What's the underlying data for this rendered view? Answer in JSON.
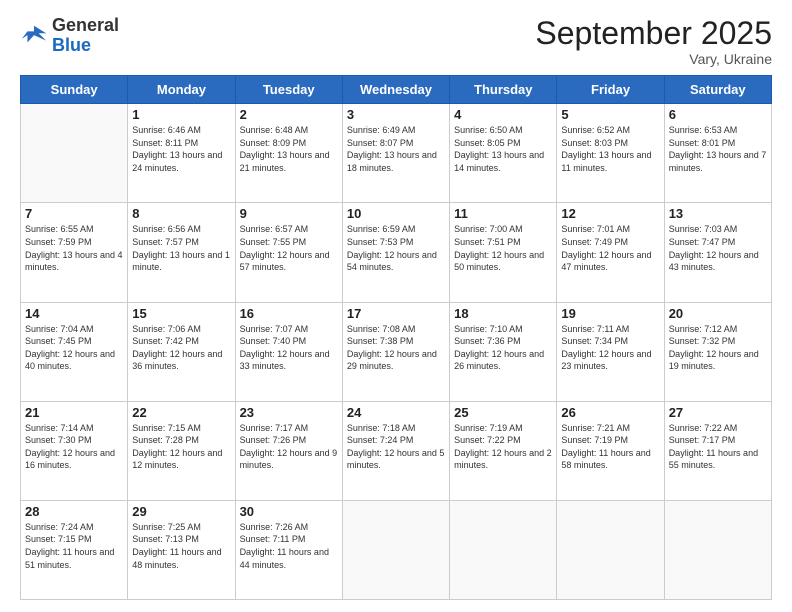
{
  "logo": {
    "text_general": "General",
    "text_blue": "Blue"
  },
  "header": {
    "month": "September 2025",
    "location": "Vary, Ukraine"
  },
  "weekdays": [
    "Sunday",
    "Monday",
    "Tuesday",
    "Wednesday",
    "Thursday",
    "Friday",
    "Saturday"
  ],
  "weeks": [
    [
      {
        "day": "",
        "sunrise": "",
        "sunset": "",
        "daylight": ""
      },
      {
        "day": "1",
        "sunrise": "Sunrise: 6:46 AM",
        "sunset": "Sunset: 8:11 PM",
        "daylight": "Daylight: 13 hours and 24 minutes."
      },
      {
        "day": "2",
        "sunrise": "Sunrise: 6:48 AM",
        "sunset": "Sunset: 8:09 PM",
        "daylight": "Daylight: 13 hours and 21 minutes."
      },
      {
        "day": "3",
        "sunrise": "Sunrise: 6:49 AM",
        "sunset": "Sunset: 8:07 PM",
        "daylight": "Daylight: 13 hours and 18 minutes."
      },
      {
        "day": "4",
        "sunrise": "Sunrise: 6:50 AM",
        "sunset": "Sunset: 8:05 PM",
        "daylight": "Daylight: 13 hours and 14 minutes."
      },
      {
        "day": "5",
        "sunrise": "Sunrise: 6:52 AM",
        "sunset": "Sunset: 8:03 PM",
        "daylight": "Daylight: 13 hours and 11 minutes."
      },
      {
        "day": "6",
        "sunrise": "Sunrise: 6:53 AM",
        "sunset": "Sunset: 8:01 PM",
        "daylight": "Daylight: 13 hours and 7 minutes."
      }
    ],
    [
      {
        "day": "7",
        "sunrise": "Sunrise: 6:55 AM",
        "sunset": "Sunset: 7:59 PM",
        "daylight": "Daylight: 13 hours and 4 minutes."
      },
      {
        "day": "8",
        "sunrise": "Sunrise: 6:56 AM",
        "sunset": "Sunset: 7:57 PM",
        "daylight": "Daylight: 13 hours and 1 minute."
      },
      {
        "day": "9",
        "sunrise": "Sunrise: 6:57 AM",
        "sunset": "Sunset: 7:55 PM",
        "daylight": "Daylight: 12 hours and 57 minutes."
      },
      {
        "day": "10",
        "sunrise": "Sunrise: 6:59 AM",
        "sunset": "Sunset: 7:53 PM",
        "daylight": "Daylight: 12 hours and 54 minutes."
      },
      {
        "day": "11",
        "sunrise": "Sunrise: 7:00 AM",
        "sunset": "Sunset: 7:51 PM",
        "daylight": "Daylight: 12 hours and 50 minutes."
      },
      {
        "day": "12",
        "sunrise": "Sunrise: 7:01 AM",
        "sunset": "Sunset: 7:49 PM",
        "daylight": "Daylight: 12 hours and 47 minutes."
      },
      {
        "day": "13",
        "sunrise": "Sunrise: 7:03 AM",
        "sunset": "Sunset: 7:47 PM",
        "daylight": "Daylight: 12 hours and 43 minutes."
      }
    ],
    [
      {
        "day": "14",
        "sunrise": "Sunrise: 7:04 AM",
        "sunset": "Sunset: 7:45 PM",
        "daylight": "Daylight: 12 hours and 40 minutes."
      },
      {
        "day": "15",
        "sunrise": "Sunrise: 7:06 AM",
        "sunset": "Sunset: 7:42 PM",
        "daylight": "Daylight: 12 hours and 36 minutes."
      },
      {
        "day": "16",
        "sunrise": "Sunrise: 7:07 AM",
        "sunset": "Sunset: 7:40 PM",
        "daylight": "Daylight: 12 hours and 33 minutes."
      },
      {
        "day": "17",
        "sunrise": "Sunrise: 7:08 AM",
        "sunset": "Sunset: 7:38 PM",
        "daylight": "Daylight: 12 hours and 29 minutes."
      },
      {
        "day": "18",
        "sunrise": "Sunrise: 7:10 AM",
        "sunset": "Sunset: 7:36 PM",
        "daylight": "Daylight: 12 hours and 26 minutes."
      },
      {
        "day": "19",
        "sunrise": "Sunrise: 7:11 AM",
        "sunset": "Sunset: 7:34 PM",
        "daylight": "Daylight: 12 hours and 23 minutes."
      },
      {
        "day": "20",
        "sunrise": "Sunrise: 7:12 AM",
        "sunset": "Sunset: 7:32 PM",
        "daylight": "Daylight: 12 hours and 19 minutes."
      }
    ],
    [
      {
        "day": "21",
        "sunrise": "Sunrise: 7:14 AM",
        "sunset": "Sunset: 7:30 PM",
        "daylight": "Daylight: 12 hours and 16 minutes."
      },
      {
        "day": "22",
        "sunrise": "Sunrise: 7:15 AM",
        "sunset": "Sunset: 7:28 PM",
        "daylight": "Daylight: 12 hours and 12 minutes."
      },
      {
        "day": "23",
        "sunrise": "Sunrise: 7:17 AM",
        "sunset": "Sunset: 7:26 PM",
        "daylight": "Daylight: 12 hours and 9 minutes."
      },
      {
        "day": "24",
        "sunrise": "Sunrise: 7:18 AM",
        "sunset": "Sunset: 7:24 PM",
        "daylight": "Daylight: 12 hours and 5 minutes."
      },
      {
        "day": "25",
        "sunrise": "Sunrise: 7:19 AM",
        "sunset": "Sunset: 7:22 PM",
        "daylight": "Daylight: 12 hours and 2 minutes."
      },
      {
        "day": "26",
        "sunrise": "Sunrise: 7:21 AM",
        "sunset": "Sunset: 7:19 PM",
        "daylight": "Daylight: 11 hours and 58 minutes."
      },
      {
        "day": "27",
        "sunrise": "Sunrise: 7:22 AM",
        "sunset": "Sunset: 7:17 PM",
        "daylight": "Daylight: 11 hours and 55 minutes."
      }
    ],
    [
      {
        "day": "28",
        "sunrise": "Sunrise: 7:24 AM",
        "sunset": "Sunset: 7:15 PM",
        "daylight": "Daylight: 11 hours and 51 minutes."
      },
      {
        "day": "29",
        "sunrise": "Sunrise: 7:25 AM",
        "sunset": "Sunset: 7:13 PM",
        "daylight": "Daylight: 11 hours and 48 minutes."
      },
      {
        "day": "30",
        "sunrise": "Sunrise: 7:26 AM",
        "sunset": "Sunset: 7:11 PM",
        "daylight": "Daylight: 11 hours and 44 minutes."
      },
      {
        "day": "",
        "sunrise": "",
        "sunset": "",
        "daylight": ""
      },
      {
        "day": "",
        "sunrise": "",
        "sunset": "",
        "daylight": ""
      },
      {
        "day": "",
        "sunrise": "",
        "sunset": "",
        "daylight": ""
      },
      {
        "day": "",
        "sunrise": "",
        "sunset": "",
        "daylight": ""
      }
    ]
  ]
}
